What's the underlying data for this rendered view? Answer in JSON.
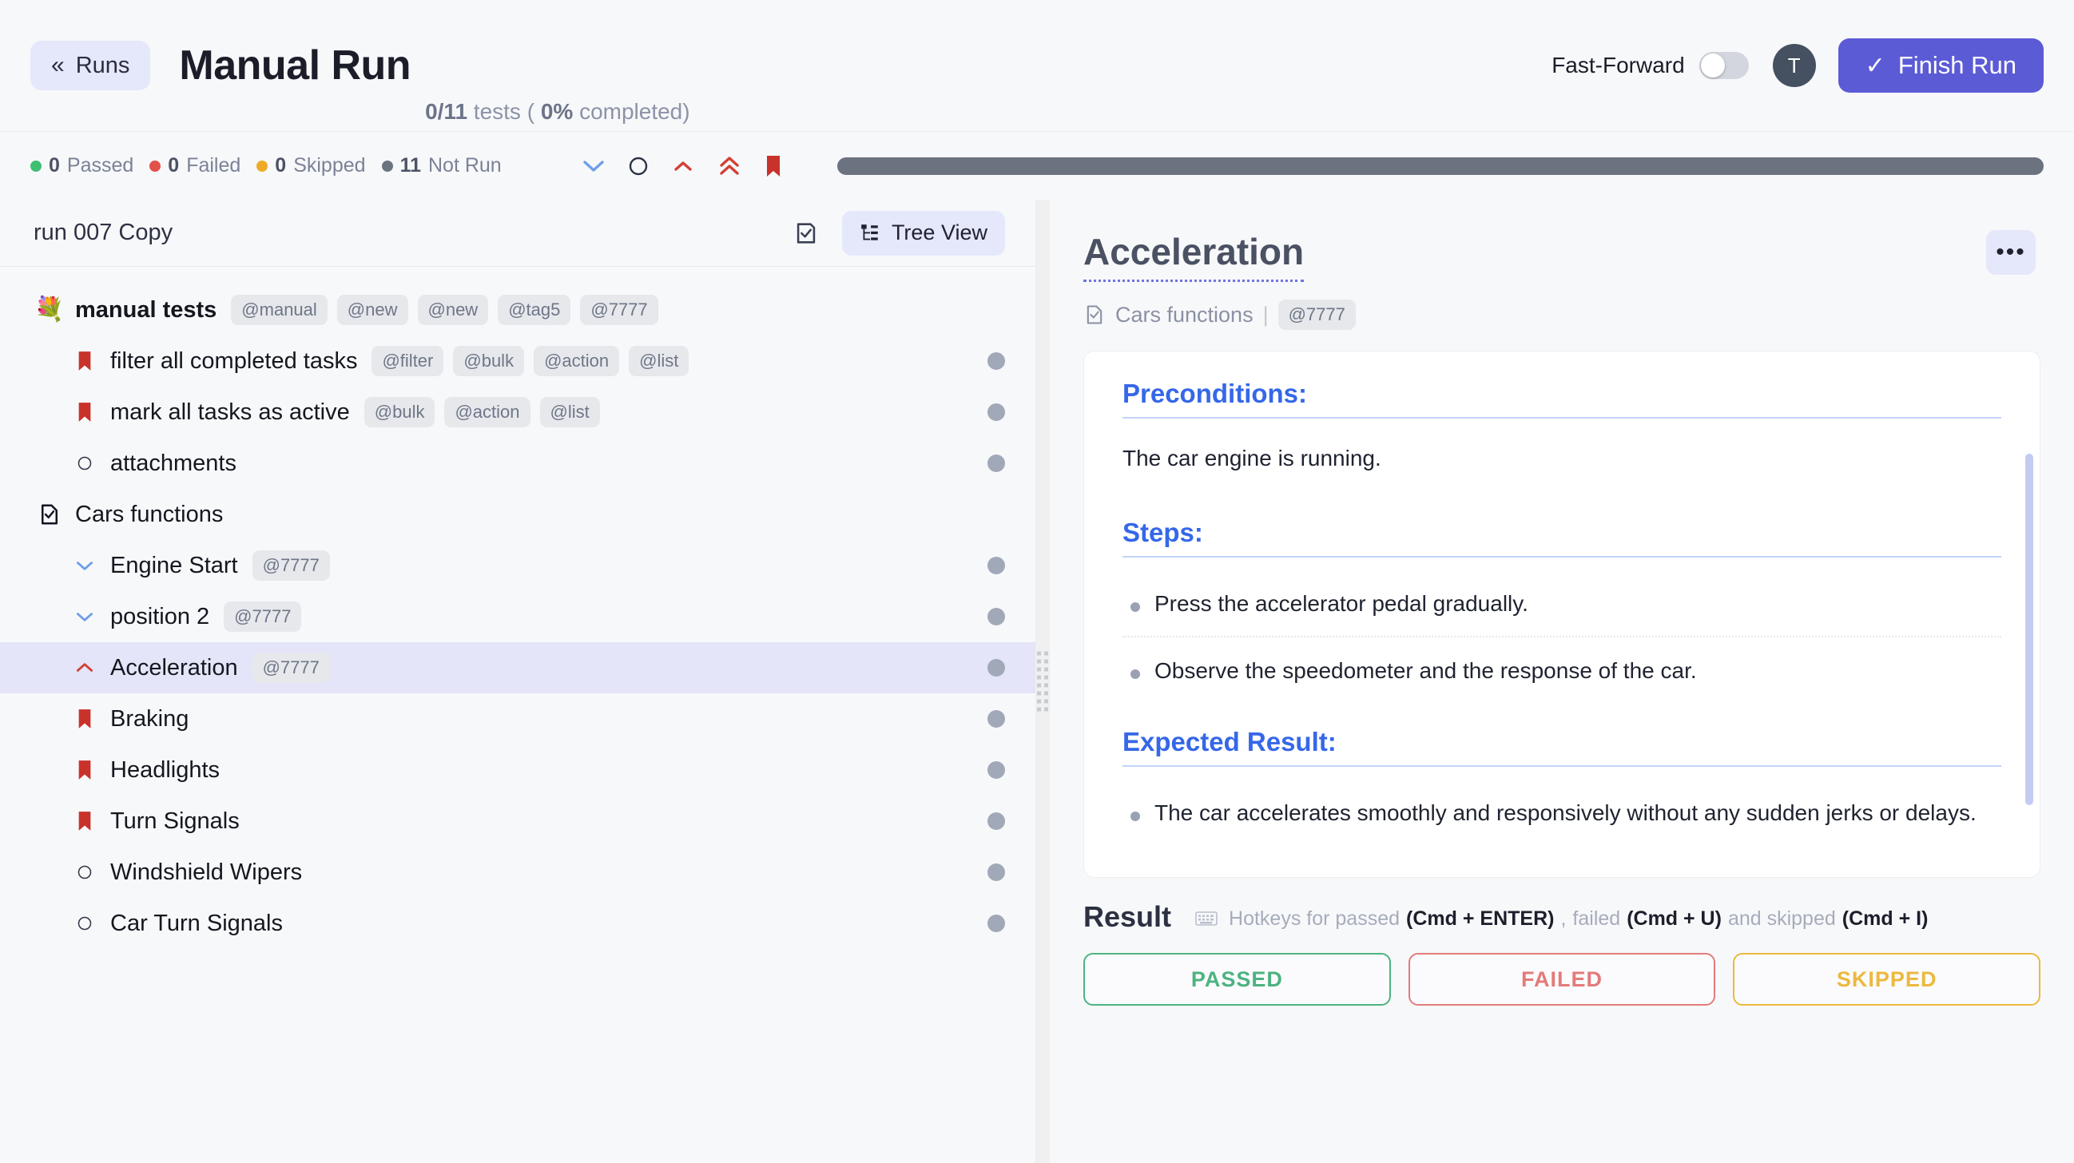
{
  "header": {
    "back_label": "Runs",
    "back_icon": "chevron-double-left-icon",
    "title": "Manual Run",
    "meta_count": "0/11",
    "meta_tests_word": "tests (",
    "meta_percent": "0%",
    "meta_completed_word": "completed)",
    "fast_forward_label": "Fast-Forward",
    "fast_forward_on": false,
    "avatar_initial": "T",
    "finish_label": "Finish Run",
    "finish_icon": "check-icon",
    "accent_color": "#5b5bd6"
  },
  "status": {
    "items": [
      {
        "count": "0",
        "label": "Passed",
        "color": "#3fbf74"
      },
      {
        "count": "0",
        "label": "Failed",
        "color": "#e1524a"
      },
      {
        "count": "0",
        "label": "Skipped",
        "color": "#edab28"
      },
      {
        "count": "11",
        "label": "Not Run",
        "color": "#6b7280"
      }
    ],
    "priority_icons": [
      {
        "name": "chevron-down-icon",
        "color": "#6f9fe8"
      },
      {
        "name": "circle-icon",
        "color": "#2b3445"
      },
      {
        "name": "chevron-up-icon",
        "color": "#d23f35"
      },
      {
        "name": "double-chevron-up-icon",
        "color": "#d23f35"
      },
      {
        "name": "bookmark-icon",
        "color": "#c8322a"
      }
    ],
    "progress": [
      {
        "label": "Not Run",
        "percent": 100,
        "color": "#6b7280"
      }
    ]
  },
  "left_pane": {
    "run_name": "run 007 Copy",
    "checklist_icon": "clipboard-check-icon",
    "tree_view_label": "Tree View",
    "tree_view_icon": "tree-view-icon",
    "tree": [
      {
        "label": "manual tests",
        "icon": "bouquet-emoji-icon",
        "level": 0,
        "kind": "group",
        "tags": [
          "@manual",
          "@new",
          "@new",
          "@tag5",
          "@7777"
        ],
        "status": null,
        "selected": false
      },
      {
        "label": "filter all completed tasks",
        "icon": "bookmark-icon",
        "level": 1,
        "kind": "case",
        "tags": [
          "@filter",
          "@bulk",
          "@action",
          "@list"
        ],
        "status": "not-run",
        "selected": false
      },
      {
        "label": "mark all tasks as active",
        "icon": "bookmark-icon",
        "level": 1,
        "kind": "case",
        "tags": [
          "@bulk",
          "@action",
          "@list"
        ],
        "status": "not-run",
        "selected": false
      },
      {
        "label": "attachments",
        "icon": "circle-icon",
        "level": 1,
        "kind": "case",
        "tags": [],
        "status": "not-run",
        "selected": false
      },
      {
        "label": "Cars functions",
        "icon": "file-check-icon",
        "level": 0,
        "kind": "suite",
        "tags": [],
        "status": null,
        "selected": false
      },
      {
        "label": "Engine Start",
        "icon": "chevron-down-icon",
        "level": 1,
        "kind": "case",
        "tags": [
          "@7777"
        ],
        "status": "not-run",
        "selected": false
      },
      {
        "label": "position 2",
        "icon": "chevron-down-icon",
        "level": 1,
        "kind": "case",
        "tags": [
          "@7777"
        ],
        "status": "not-run",
        "selected": false
      },
      {
        "label": "Acceleration",
        "icon": "chevron-up-icon",
        "level": 1,
        "kind": "case",
        "tags": [
          "@7777"
        ],
        "status": "not-run",
        "selected": true
      },
      {
        "label": "Braking",
        "icon": "bookmark-icon",
        "level": 1,
        "kind": "case",
        "tags": [],
        "status": "not-run",
        "selected": false
      },
      {
        "label": "Headlights",
        "icon": "bookmark-icon",
        "level": 1,
        "kind": "case",
        "tags": [],
        "status": "not-run",
        "selected": false
      },
      {
        "label": "Turn Signals",
        "icon": "bookmark-icon",
        "level": 1,
        "kind": "case",
        "tags": [],
        "status": "not-run",
        "selected": false
      },
      {
        "label": "Windshield Wipers",
        "icon": "circle-icon",
        "level": 1,
        "kind": "case",
        "tags": [],
        "status": "not-run",
        "selected": false
      },
      {
        "label": "Car Turn Signals",
        "icon": "circle-icon",
        "level": 1,
        "kind": "case",
        "tags": [],
        "status": "not-run",
        "selected": false
      }
    ]
  },
  "detail": {
    "title": "Acceleration",
    "suite_icon": "file-check-icon",
    "suite_name": "Cars functions",
    "separator": "|",
    "tag": "@7777",
    "more_label": "•••",
    "sections": {
      "preconditions_heading": "Preconditions:",
      "preconditions_text": "The car engine is running.",
      "steps_heading": "Steps:",
      "steps": [
        "Press the accelerator pedal gradually.",
        "Observe the speedometer and the response of the car."
      ],
      "expected_heading": "Expected Result:",
      "expected": [
        "The car accelerates smoothly and responsively without any sudden jerks or delays."
      ]
    },
    "result": {
      "title": "Result",
      "keyboard_icon": "keyboard-icon",
      "hotkeys_prefix": "Hotkeys for passed",
      "hotkey_passed": "(Cmd + ENTER)",
      "hotkeys_comma": ",",
      "hotkeys_failed_word": "failed",
      "hotkey_failed": "(Cmd + U)",
      "hotkeys_and_word": "and skipped",
      "hotkey_skipped": "(Cmd + I)",
      "buttons": [
        {
          "label": "PASSED",
          "color": "#4cb380"
        },
        {
          "label": "FAILED",
          "color": "#e37b7b"
        },
        {
          "label": "SKIPPED",
          "color": "#ecb93f"
        }
      ]
    }
  }
}
